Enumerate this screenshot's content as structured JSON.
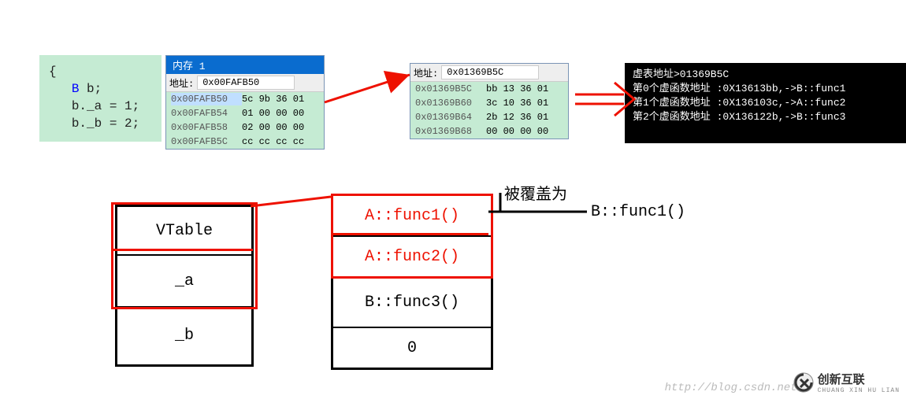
{
  "code": {
    "line_open": "{",
    "line1_type": "B ",
    "line1_rest": "b;",
    "line2": "b._a = 1;",
    "line3": "b._b = 2;"
  },
  "mem1": {
    "title": "内存 1",
    "addr_label": "地址:",
    "addr_value": "0x00FAFB50",
    "rows": [
      {
        "addr": "0x00FAFB50",
        "bytes": "5c 9b 36 01",
        "hl": true
      },
      {
        "addr": "0x00FAFB54",
        "bytes": "01 00 00 00"
      },
      {
        "addr": "0x00FAFB58",
        "bytes": "02 00 00 00",
        "red": true
      },
      {
        "addr": "0x00FAFB5C",
        "bytes": "cc cc cc cc",
        "gray": true
      }
    ]
  },
  "mem2": {
    "addr_label": "地址:",
    "addr_value": "0x01369B5C",
    "rows": [
      {
        "addr": "0x01369B5C",
        "bytes": "bb 13 36 01"
      },
      {
        "addr": "0x01369B60",
        "bytes": "3c 10 36 01"
      },
      {
        "addr": "0x01369B64",
        "bytes": "2b 12 36 01"
      },
      {
        "addr": "0x01369B68",
        "bytes": "00 00 00 00"
      }
    ]
  },
  "console": {
    "l1": "虚表地址>01369B5C",
    "l2": "第0个虚函数地址 :0X13613bb,->B::func1",
    "l3": "第1个虚函数地址 :0X136103c,->A::func2",
    "l4": "第2个虚函数地址 :0X136122b,->B::func3"
  },
  "obj": {
    "cell0": "VTable",
    "cell1": "_a",
    "cell2": "_b"
  },
  "vt": {
    "cell0": "A::func1()",
    "cell1": "A::func2()",
    "cell2": "B::func3()",
    "cell3": "0"
  },
  "annot": {
    "overwritten_label": "被覆盖为",
    "overwritten_value": "B::func1()"
  },
  "watermark": {
    "url": "http://blog.csdn.net/",
    "logo_cn": "创新互联",
    "logo_en": "CHUANG XIN HU LIAN"
  }
}
